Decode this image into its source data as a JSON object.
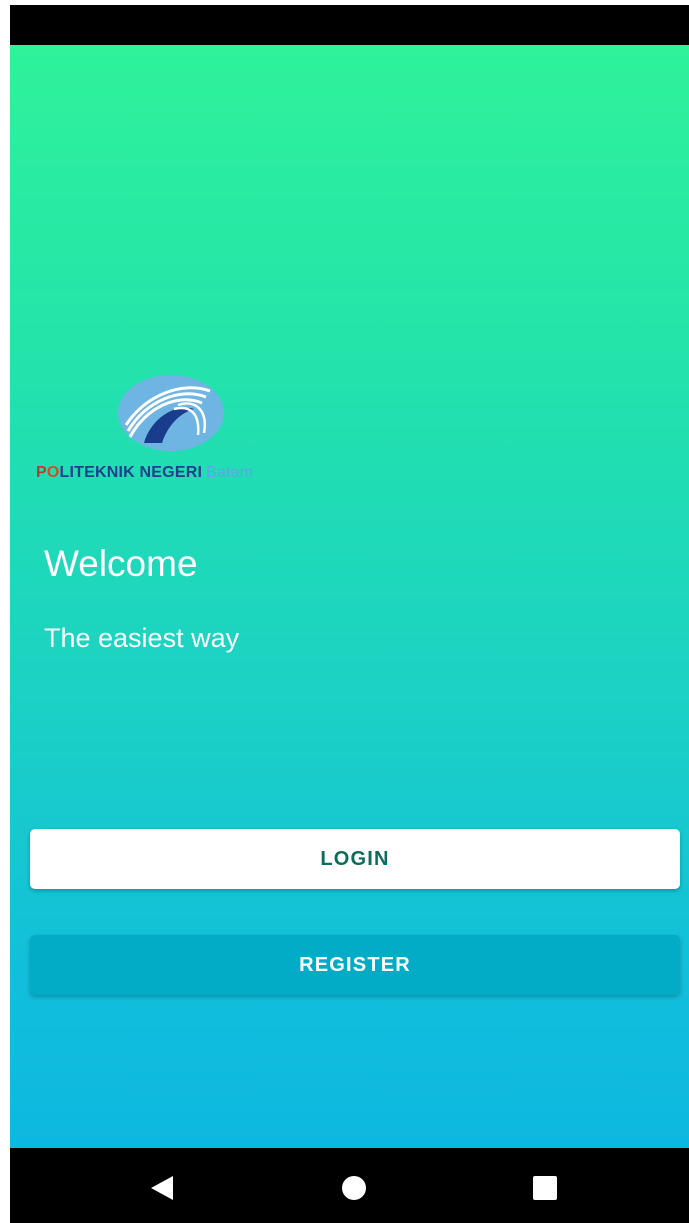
{
  "logo": {
    "brand_p": "P",
    "brand_o": "O",
    "brand_rest": "LITEKNIK NEGERI",
    "brand_city": "Batam"
  },
  "welcome": {
    "title": "Welcome",
    "subtitle": "The easiest way"
  },
  "buttons": {
    "login_label": "LOGIN",
    "register_label": "REGISTER"
  },
  "navigation": {
    "back_icon": "back-triangle-icon",
    "home_icon": "home-circle-icon",
    "recent_icon": "recent-square-icon"
  },
  "colors": {
    "gradient_top": "#2ff29a",
    "gradient_bottom": "#0db8e0",
    "login_bg": "#ffffff",
    "login_text": "#0f6b5c",
    "register_bg": "#03acc6",
    "register_text": "#ffffff"
  }
}
